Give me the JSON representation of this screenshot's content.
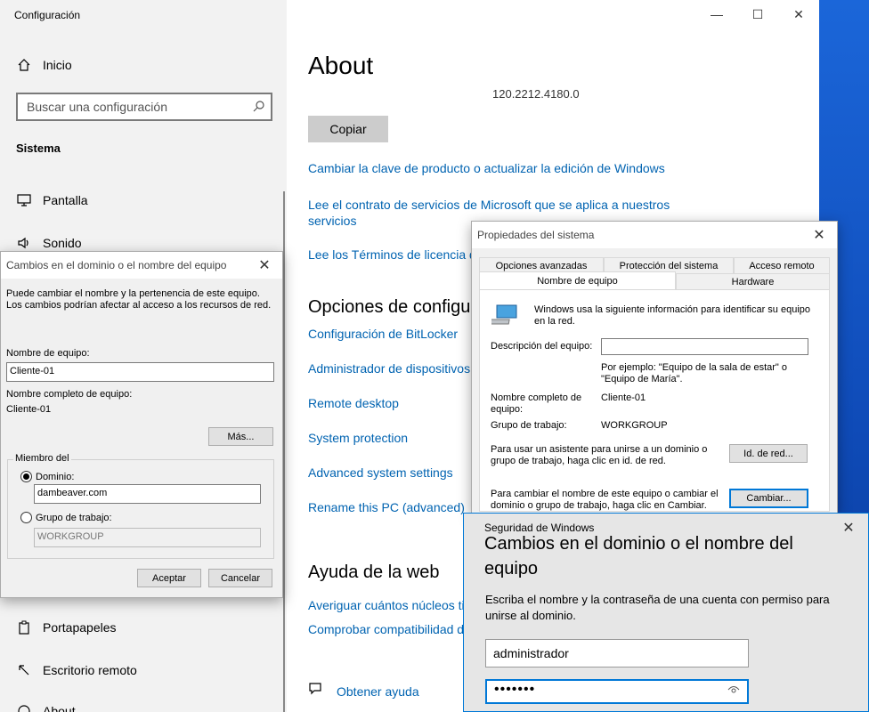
{
  "settings": {
    "window_title": "Configuración",
    "controls": {
      "minimize": "—",
      "maximize": "☐",
      "close": "✕"
    },
    "sidebar": {
      "home": "Inicio",
      "search_placeholder": "Buscar una configuración",
      "section": "Sistema",
      "items": [
        {
          "label": "Pantalla"
        },
        {
          "label": "Sonido"
        },
        {
          "label": "Portapapeles"
        },
        {
          "label": "Escritorio remoto"
        },
        {
          "label": "About"
        }
      ]
    },
    "main": {
      "title": "About",
      "version": "120.2212.4180.0",
      "copy_button": "Copiar",
      "links_top": [
        "Cambiar la clave de producto o actualizar la edición de Windows",
        "Lee el contrato de servicios de Microsoft que se aplica a nuestros servicios",
        "Lee los Términos de licencia de"
      ],
      "related_heading": "Opciones de configu",
      "related_links": [
        "Configuración de BitLocker",
        "Administrador de dispositivos",
        "Remote desktop",
        "System protection",
        "Advanced system settings",
        "Rename this PC (advanced)"
      ],
      "web_heading": "Ayuda de la web",
      "web_links": [
        "Averiguar cuántos núcleos ti",
        "Comprobar compatibilidad d"
      ],
      "help_link": "Obtener ayuda"
    }
  },
  "domain_dialog": {
    "title": "Cambios en el dominio o el nombre del equipo",
    "intro": "Puede cambiar el nombre y la pertenencia de este equipo. Los cambios podrían afectar al acceso a los recursos de red.",
    "computer_name_label": "Nombre de equipo:",
    "computer_name_value": "Cliente-01",
    "full_name_label": "Nombre completo de equipo:",
    "full_name_value": "Cliente-01",
    "more_button": "Más...",
    "member_of": "Miembro del",
    "domain_label": "Dominio:",
    "domain_value": "dambeaver.com",
    "workgroup_label": "Grupo de trabajo:",
    "workgroup_value": "WORKGROUP",
    "ok_button": "Aceptar",
    "cancel_button": "Cancelar"
  },
  "sysprops": {
    "title": "Propiedades del sistema",
    "tabs_top": [
      "Opciones avanzadas",
      "Protección del sistema",
      "Acceso remoto"
    ],
    "tabs_bottom": [
      "Nombre de equipo",
      "Hardware"
    ],
    "info": "Windows usa la siguiente información para identificar su equipo en la red.",
    "description_label": "Descripción del equipo:",
    "example": "Por ejemplo: \"Equipo de la sala de estar\" o \"Equipo de María\".",
    "fullname_label": "Nombre completo de equipo:",
    "fullname_value": "Cliente-01",
    "workgroup_label": "Grupo de trabajo:",
    "workgroup_value": "WORKGROUP",
    "netid_text": "Para usar un asistente para unirse a un dominio o grupo de trabajo, haga clic en id. de red.",
    "netid_button": "Id. de red...",
    "rename_text": "Para cambiar el nombre de este equipo o cambiar el dominio o grupo de trabajo, haga clic en Cambiar.",
    "change_button": "Cambiar..."
  },
  "winsec": {
    "title": "Seguridad de Windows",
    "heading": "Cambios en el dominio o el nombre del equipo",
    "desc": "Escriba el nombre y la contraseña de una cuenta con permiso para unirse al dominio.",
    "username": "administrador",
    "password_mask": "•••••••"
  }
}
